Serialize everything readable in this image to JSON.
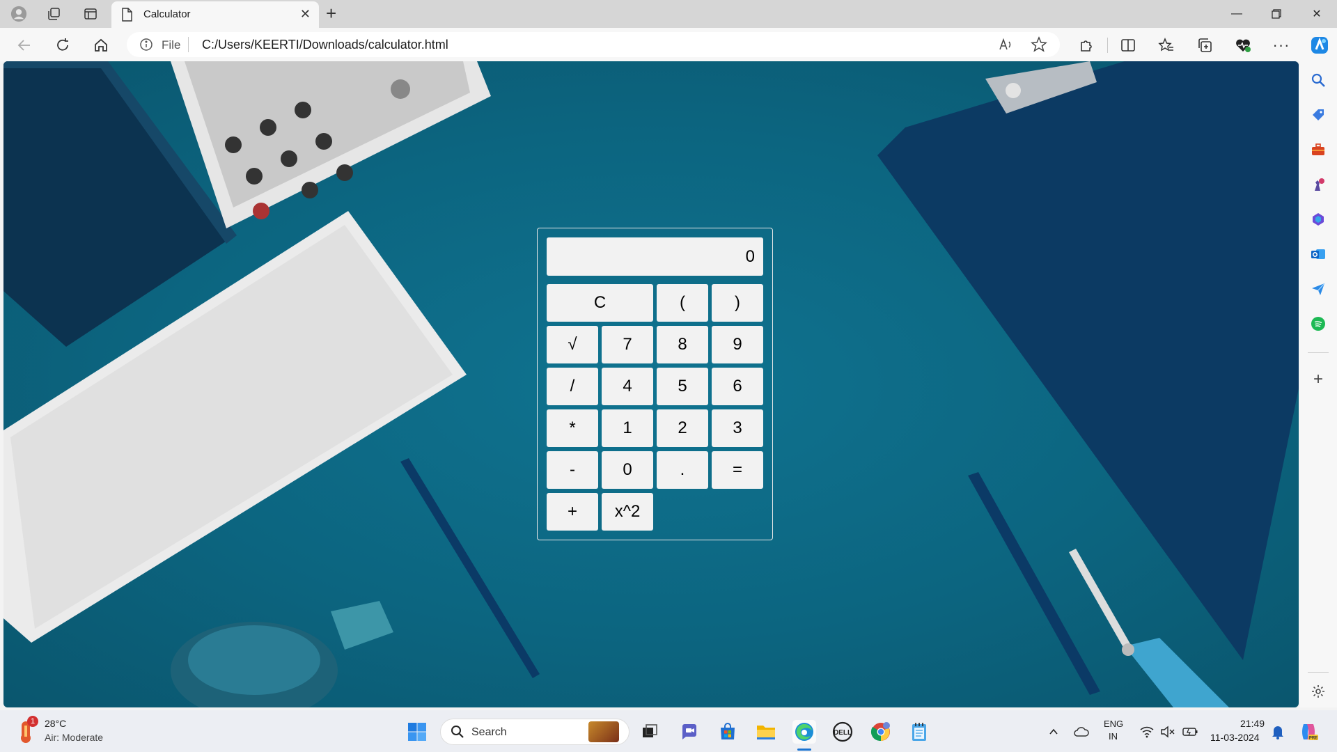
{
  "browser": {
    "tab_title": "Calculator",
    "address_prefix": "File",
    "url": "C:/Users/KEERTI/Downloads/calculator.html"
  },
  "calculator": {
    "display_value": "0",
    "keys": [
      "C",
      "(",
      ")",
      "√",
      "7",
      "8",
      "9",
      "/",
      "4",
      "5",
      "6",
      "*",
      "1",
      "2",
      "3",
      "-",
      "0",
      ".",
      "=",
      "+",
      "x^2"
    ]
  },
  "taskbar": {
    "weather_temp": "28°C",
    "weather_desc": "Air: Moderate",
    "weather_badge": "1",
    "search_label": "Search",
    "lang_line1": "ENG",
    "lang_line2": "IN",
    "time": "21:49",
    "date": "11-03-2024"
  },
  "colors": {
    "background_teal": "#0c6580",
    "calc_button": "#f2f2f2",
    "calc_border": "#e8e8e8"
  }
}
